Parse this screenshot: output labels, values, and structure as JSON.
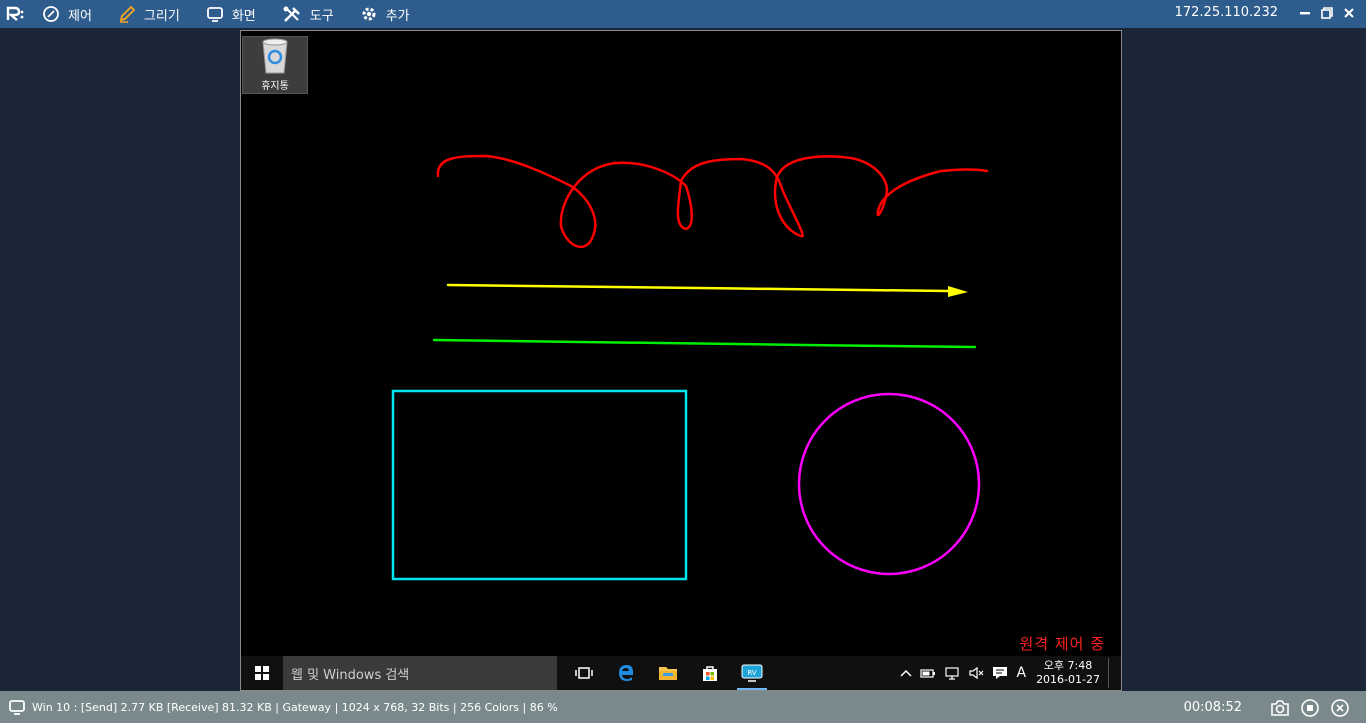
{
  "toolbar": {
    "logo_icon": "rv-logo-icon",
    "menu": [
      {
        "label": "제어",
        "icon": "control-icon"
      },
      {
        "label": "그리기",
        "icon": "pencil-icon"
      },
      {
        "label": "화면",
        "icon": "monitor-icon"
      },
      {
        "label": "도구",
        "icon": "tools-icon"
      },
      {
        "label": "추가",
        "icon": "gear-icon"
      }
    ],
    "ip": "172.25.110.232"
  },
  "desktop": {
    "recycle_bin_label": "휴지통",
    "remote_status": "원격 제어 중",
    "drawing_colors": {
      "freehand": "#ff0000",
      "arrow": "#ffff00",
      "line": "#00ff00",
      "rectangle": "#00e5ee",
      "circle": "#ff00ff"
    }
  },
  "taskbar": {
    "search_placeholder": "웹 및 Windows 검색",
    "clock_time": "오후 7:48",
    "clock_date": "2016-01-27",
    "ime": "A"
  },
  "statusbar": {
    "info": "Win 10 : [Send] 2.77 KB  [Receive] 81.32 KB | Gateway | 1024 x 768, 32 Bits | 256 Colors | 86 %",
    "timer": "00:08:52"
  }
}
